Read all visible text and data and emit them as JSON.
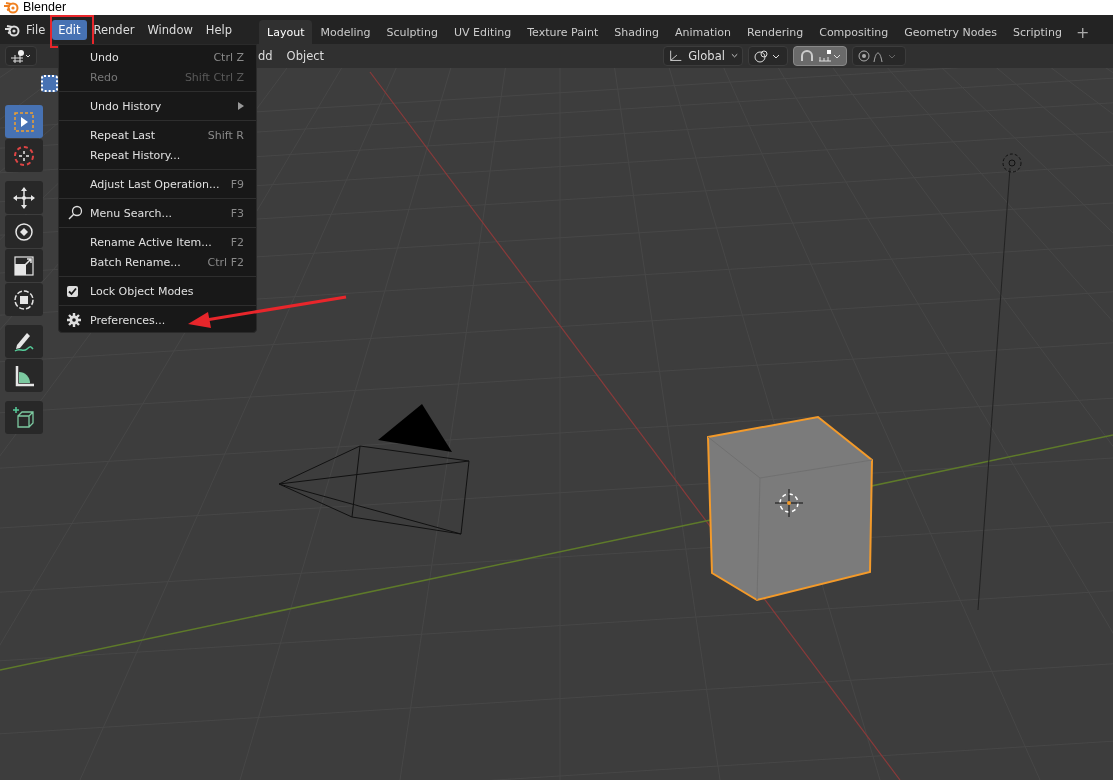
{
  "window": {
    "title": "Blender"
  },
  "menubar": [
    {
      "label": "File",
      "selected": false
    },
    {
      "label": "Edit",
      "selected": true
    },
    {
      "label": "Render",
      "selected": false
    },
    {
      "label": "Window",
      "selected": false
    },
    {
      "label": "Help",
      "selected": false
    }
  ],
  "workspace_tabs": [
    {
      "label": "Layout",
      "selected": true
    },
    {
      "label": "Modeling",
      "selected": false
    },
    {
      "label": "Sculpting",
      "selected": false
    },
    {
      "label": "UV Editing",
      "selected": false
    },
    {
      "label": "Texture Paint",
      "selected": false
    },
    {
      "label": "Shading",
      "selected": false
    },
    {
      "label": "Animation",
      "selected": false
    },
    {
      "label": "Rendering",
      "selected": false
    },
    {
      "label": "Compositing",
      "selected": false
    },
    {
      "label": "Geometry Nodes",
      "selected": false
    },
    {
      "label": "Scripting",
      "selected": false
    }
  ],
  "add_workspace": "+",
  "header": {
    "menus": [
      "dd",
      "Object"
    ],
    "orientation": "Global",
    "snap_on": true,
    "proportional_on": false
  },
  "toolbar": [
    {
      "kind": "select",
      "selected": true
    },
    {
      "kind": "cursor",
      "selected": false
    },
    {
      "kind": "move",
      "selected": false
    },
    {
      "kind": "rotate",
      "selected": false
    },
    {
      "kind": "scale",
      "selected": false
    },
    {
      "kind": "transform",
      "selected": false
    },
    {
      "kind": "annotate",
      "selected": false
    },
    {
      "kind": "measure",
      "selected": false
    },
    {
      "kind": "add",
      "selected": false
    }
  ],
  "edit_menu": [
    {
      "kind": "item",
      "label": "Undo",
      "shortcut": "Ctrl Z",
      "disabled": false
    },
    {
      "kind": "item",
      "label": "Redo",
      "shortcut": "Shift Ctrl Z",
      "disabled": true
    },
    {
      "kind": "separator"
    },
    {
      "kind": "submenu",
      "label": "Undo History",
      "disabled": false
    },
    {
      "kind": "separator"
    },
    {
      "kind": "item",
      "label": "Repeat Last",
      "shortcut": "Shift R",
      "disabled": false
    },
    {
      "kind": "item",
      "label": "Repeat History...",
      "disabled": false
    },
    {
      "kind": "separator"
    },
    {
      "kind": "item",
      "label": "Adjust Last Operation...",
      "shortcut": "F9",
      "disabled": false
    },
    {
      "kind": "separator"
    },
    {
      "kind": "search",
      "label": "Menu Search...",
      "shortcut": "F3",
      "disabled": false
    },
    {
      "kind": "separator"
    },
    {
      "kind": "item",
      "label": "Rename Active Item...",
      "shortcut": "F2",
      "disabled": false
    },
    {
      "kind": "item",
      "label": "Batch Rename...",
      "shortcut": "Ctrl F2",
      "disabled": false
    },
    {
      "kind": "separator"
    },
    {
      "kind": "checkbox",
      "label": "Lock Object Modes",
      "checked": true,
      "disabled": false
    },
    {
      "kind": "separator"
    },
    {
      "kind": "settings",
      "label": "Preferences...",
      "disabled": false
    }
  ]
}
